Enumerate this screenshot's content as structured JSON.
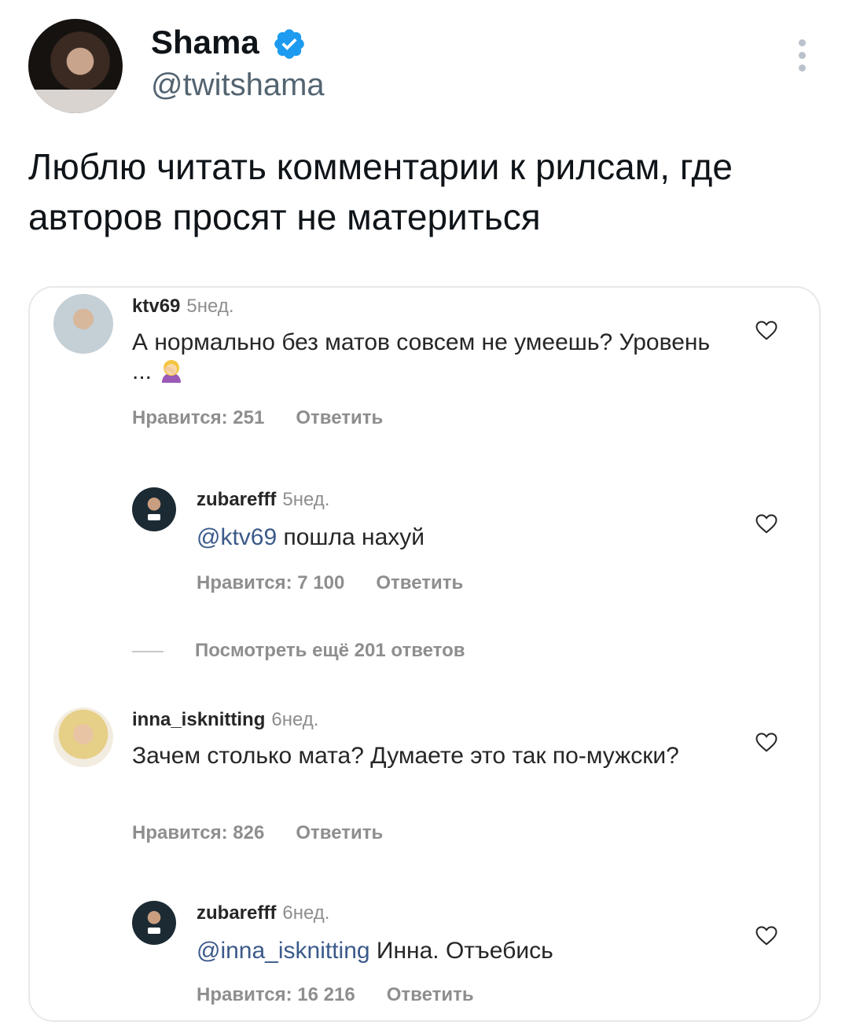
{
  "tweet": {
    "author_name": "Shama",
    "author_handle": "@twitshama",
    "text": "Люблю читать комментарии к рилсам, где авторов просят не материться"
  },
  "comments": [
    {
      "username": "ktv69",
      "time": "5нед.",
      "text": "А нормально без матов совсем не умеешь? Уровень ...",
      "emoji": "facepalm-emoji",
      "likes": "Нравится: 251",
      "reply": "Ответить"
    },
    {
      "username": "zubarefff",
      "time": "5нед.",
      "mention": "@ktv69",
      "text": " пошла нахуй",
      "likes": "Нравится: 7 100",
      "reply": "Ответить"
    },
    {
      "username": "inna_isknitting",
      "time": "6нед.",
      "text": "Зачем столько мата? Думаете это так по-мужски?",
      "likes": "Нравится: 826",
      "reply": "Ответить"
    },
    {
      "username": "zubarefff",
      "time": "6нед.",
      "mention": "@inna_isknitting",
      "text": " Инна. Отъебись",
      "likes": "Нравится: 16 216",
      "reply": "Ответить"
    }
  ],
  "more_replies": "Посмотреть ещё 201 ответов",
  "colors": {
    "verified": "#1d9bf0",
    "mention": "#3b5a8a",
    "meta": "#8e8e8e"
  }
}
